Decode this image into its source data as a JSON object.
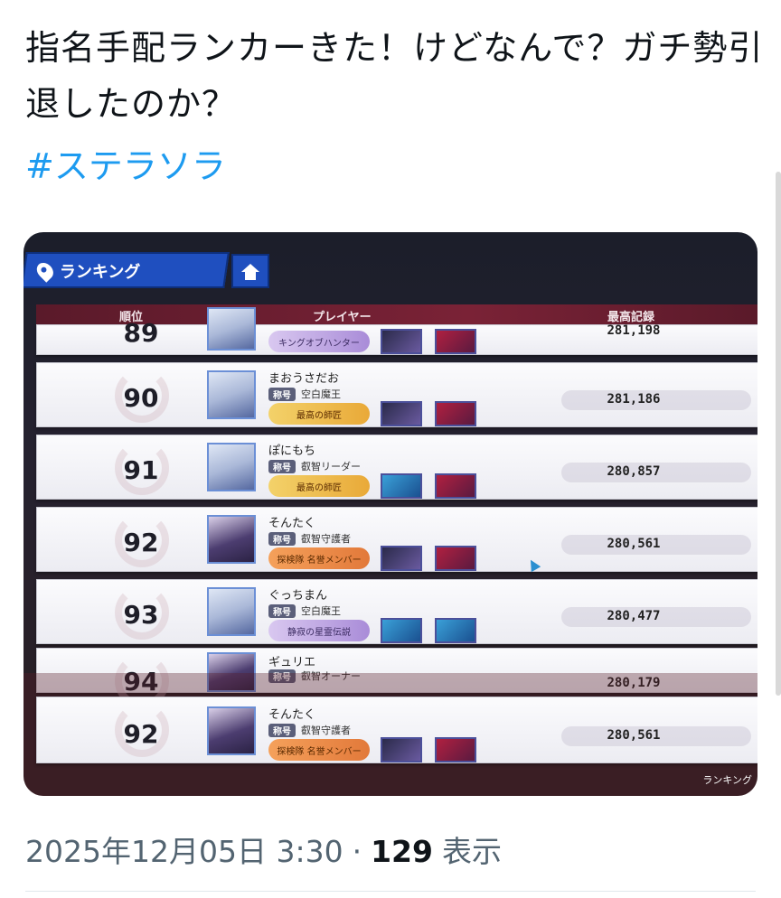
{
  "tweet": {
    "text": "指名手配ランカーきた！けどなんで？ガチ勢引退したのか？",
    "hashtag": "#ステラソラ",
    "date": "2025年12月05日 3:30",
    "separator": "·",
    "view_count": "129",
    "view_label": "表示"
  },
  "game": {
    "header_title": "ランキング",
    "columns": {
      "rank": "順位",
      "player": "プレイヤー",
      "score": "最高記録"
    },
    "bottom_tag": "ランキング",
    "rows": [
      {
        "rank": "89",
        "name": "",
        "title": "",
        "badge": "キングオブハンター",
        "badge_style": "purple",
        "score": "281,198"
      },
      {
        "rank": "90",
        "name": "まおうさだお",
        "title_label": "称号",
        "title": "空白魔王",
        "badge": "最高の師匠",
        "badge_style": "gold",
        "score": "281,186"
      },
      {
        "rank": "91",
        "name": "ぽにもち",
        "title_label": "称号",
        "title": "叡智リーダー",
        "badge": "最高の師匠",
        "badge_style": "gold",
        "score": "280,857"
      },
      {
        "rank": "92",
        "name": "そんたく",
        "title_label": "称号",
        "title": "叡智守護者",
        "badge": "探検隊 名誉メンバー",
        "badge_style": "orange",
        "score": "280,561"
      },
      {
        "rank": "93",
        "name": "ぐっちまん",
        "title_label": "称号",
        "title": "空白魔王",
        "badge": "静寂の星霊伝説",
        "badge_style": "purple",
        "score": "280,477"
      },
      {
        "rank": "94",
        "name": "ギュリエ",
        "title_label": "称号",
        "title": "叡智オーナー",
        "badge": "",
        "badge_style": "gold",
        "score": "280,179"
      },
      {
        "rank": "92",
        "name": "そんたく",
        "title_label": "称号",
        "title": "叡智守護者",
        "badge": "探検隊 名誉メンバー",
        "badge_style": "orange",
        "score": "280,561"
      }
    ]
  }
}
